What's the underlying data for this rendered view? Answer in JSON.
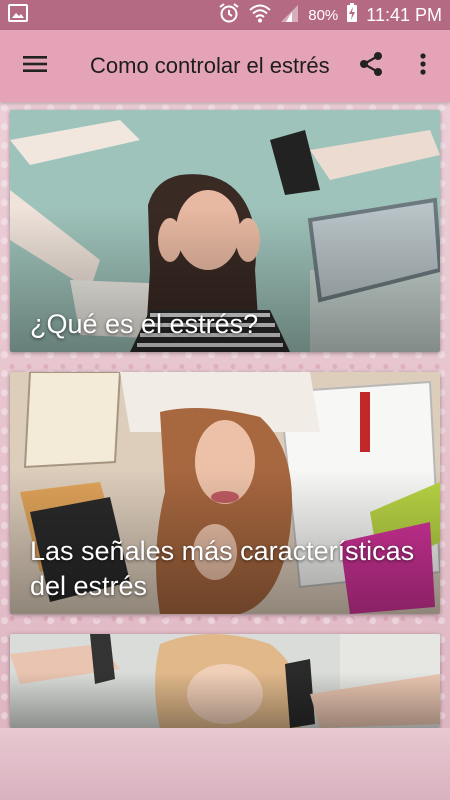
{
  "status_bar": {
    "battery": "80%",
    "time": "11:41 PM",
    "icons": [
      "image-icon",
      "alarm-icon",
      "wifi-icon",
      "signal-icon",
      "battery-charging-icon"
    ]
  },
  "app_bar": {
    "title": "Como controlar el estrés",
    "menu_icon": "hamburger-menu-icon",
    "share_icon": "share-icon",
    "more_icon": "more-vert-icon"
  },
  "cards": [
    {
      "caption": "¿Qué es el estrés?",
      "image": "stressed-woman-surrounded-by-devices"
    },
    {
      "caption": "Las señales más características del estrés",
      "image": "woman-lying-on-books-and-notebooks"
    },
    {
      "caption": "",
      "image": "woman-head-in-hands-with-phones"
    }
  ],
  "colors": {
    "status_bar": "#b56a83",
    "app_bar": "#e4a3b6",
    "background": "#e9d3da",
    "caption_text": "#ffffff"
  }
}
